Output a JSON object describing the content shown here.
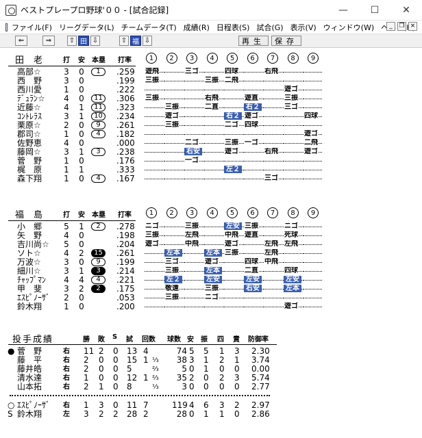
{
  "window": {
    "title": "ベストプレープロ野球'００ - [試合記録]",
    "buttons": [
      "—",
      "☐",
      "✕"
    ]
  },
  "menu": [
    "ファイル(F)",
    "リーグデータ(L)",
    "チームデータ(T)",
    "成績(R)",
    "日程表(S)",
    "試合(G)",
    "表示(V)",
    "ウィンドウ(W)",
    "ヘルプ(H)"
  ],
  "mdi_buttons": [
    "_",
    "❐",
    "×"
  ],
  "toolbar": {
    "left_arrow": "⇐",
    "right_arrow": "⇒",
    "up1": "⇧",
    "ta": "田",
    "down1": "⇩",
    "up2": "⇧",
    "fuku": "福",
    "down2": "⇩",
    "replay": "再生",
    "save": "保存"
  },
  "headers": {
    "ab": "打",
    "h": "安",
    "hr": "本塁",
    "avg": "打率",
    "innings": [
      "1",
      "2",
      "3",
      "4",
      "5",
      "6",
      "7",
      "8",
      "9"
    ]
  },
  "team1": {
    "name": "田老",
    "players": [
      {
        "name": "高部☆",
        "ab": "3",
        "h": "0",
        "hr": "1",
        "hr_style": "open",
        "avg": ".259",
        "res": [
          "遊飛",
          "",
          "三ゴ",
          "",
          "四球",
          "",
          "右飛",
          "",
          ""
        ]
      },
      {
        "name": "西　野",
        "ab": "3",
        "h": "0",
        "hr": "",
        "avg": ".199",
        "res": [
          "三振",
          "",
          "",
          "三振",
          "二飛",
          "",
          "",
          "",
          ""
        ]
      },
      {
        "name": "西川愛",
        "ab": "1",
        "h": "0",
        "hr": "",
        "avg": ".222",
        "res": [
          "",
          "",
          "",
          "",
          "",
          "",
          "",
          "遊ゴ",
          ""
        ]
      },
      {
        "name": "ﾃﾞｭﾗﾝ☆",
        "ab": "4",
        "h": "0",
        "hr": "11",
        "hr_style": "open",
        "avg": ".306",
        "res": [
          "三振",
          "",
          "",
          "右飛",
          "",
          "遊直",
          "",
          "三振",
          ""
        ]
      },
      {
        "name": "近藤☆",
        "ab": "4",
        "h": "1",
        "hr": "11",
        "hr_style": "open",
        "avg": ".323",
        "res": [
          "",
          "三振",
          "",
          "二直",
          "",
          "右２",
          "",
          "三ゴ",
          ""
        ]
      },
      {
        "name": "ｺﾝﾄﾚﾗｽ",
        "ab": "3",
        "h": "1",
        "hr": "10",
        "hr_style": "open",
        "avg": ".234",
        "res": [
          "",
          "遊ゴ",
          "",
          "",
          "右２",
          "遊ゴ",
          "",
          "",
          "四球"
        ]
      },
      {
        "name": "栗原☆",
        "ab": "2",
        "h": "0",
        "hr": "9",
        "hr_style": "open",
        "avg": ".261",
        "res": [
          "",
          "三振",
          "",
          "",
          "二ゴ",
          "四球",
          "",
          "",
          ""
        ]
      },
      {
        "name": "郡司☆",
        "ab": "1",
        "h": "0",
        "hr": "4",
        "hr_style": "open",
        "avg": ".182",
        "res": [
          "",
          "",
          "",
          "",
          "",
          "",
          "",
          "",
          "遊ゴ"
        ]
      },
      {
        "name": "佐野恵",
        "ab": "4",
        "h": "0",
        "hr": "",
        "avg": ".000",
        "res": [
          "",
          "",
          "二ゴ",
          "",
          "三振",
          "一ゴ",
          "",
          "",
          "二飛"
        ]
      },
      {
        "name": "藤岡☆",
        "ab": "3",
        "h": "1",
        "hr": "3",
        "hr_style": "open",
        "avg": ".238",
        "res": [
          "",
          "",
          "右安",
          "",
          "遊ゴ",
          "",
          "右飛",
          "",
          "遊ゴ"
        ]
      },
      {
        "name": "菅　野",
        "ab": "1",
        "h": "0",
        "hr": "",
        "avg": ".176",
        "res": [
          "",
          "",
          "一ゴ",
          "",
          "",
          "",
          "",
          "",
          ""
        ]
      },
      {
        "name": "梶　原",
        "ab": "1",
        "h": "1",
        "hr": "",
        "avg": ".333",
        "res": [
          "",
          "",
          "",
          "",
          "左２",
          "",
          "",
          "",
          ""
        ]
      },
      {
        "name": "森下翔",
        "ab": "1",
        "h": "0",
        "hr": "4",
        "hr_style": "open",
        "avg": ".167",
        "res": [
          "",
          "",
          "",
          "",
          "",
          "",
          "三ゴ",
          "",
          ""
        ]
      }
    ]
  },
  "team2": {
    "name": "福島",
    "players": [
      {
        "name": "小　郷",
        "ab": "5",
        "h": "1",
        "hr": "2",
        "hr_style": "open",
        "avg": ".278",
        "res": [
          "ニゴ",
          "",
          "三振",
          "",
          "左安",
          "三振",
          "",
          "ニゴ",
          ""
        ]
      },
      {
        "name": "矢　野",
        "ab": "4",
        "h": "0",
        "hr": "",
        "avg": ".198",
        "res": [
          "三振",
          "",
          "左飛",
          "",
          "中飛",
          "遊直",
          "",
          "死球",
          ""
        ]
      },
      {
        "name": "吉川尚☆",
        "ab": "5",
        "h": "0",
        "hr": "",
        "avg": ".204",
        "res": [
          "遊ゴ",
          "",
          "中飛",
          "",
          "遊ゴ",
          "",
          "左飛",
          "左飛",
          ""
        ]
      },
      {
        "name": "ソト☆",
        "ab": "4",
        "h": "2",
        "hr": "15",
        "hr_style": "filled",
        "avg": ".261",
        "res": [
          "",
          "左本",
          "",
          "左本",
          "三振",
          "",
          "左飛",
          "",
          ""
        ]
      },
      {
        "name": "万波☆",
        "ab": "3",
        "h": "0",
        "hr": "9",
        "hr_style": "open",
        "avg": ".199",
        "res": [
          "",
          "三ゴ",
          "",
          "遊ゴ",
          "",
          "四球",
          "中飛",
          "",
          ""
        ]
      },
      {
        "name": "細川☆",
        "ab": "3",
        "h": "1",
        "hr": "3",
        "hr_style": "filled",
        "avg": ".214",
        "res": [
          "",
          "三振",
          "",
          "左本",
          "",
          "二直",
          "",
          "四球",
          ""
        ]
      },
      {
        "name": "ﾁｬｯﾌﾟﾏﾝ",
        "ab": "4",
        "h": "4",
        "hr": "4",
        "hr_style": "open",
        "avg": ".221",
        "res": [
          "",
          "左２",
          "",
          "左安",
          "",
          "左安",
          "",
          "左安",
          ""
        ]
      },
      {
        "name": "甲　斐",
        "ab": "3",
        "h": "2",
        "hr": "2",
        "hr_style": "filled",
        "avg": ".175",
        "res": [
          "",
          "敬遠",
          "",
          "三振",
          "",
          "右安",
          "",
          "左本",
          ""
        ]
      },
      {
        "name": "ｴｽﾋﾟﾉｰｻﾞ",
        "ab": "2",
        "h": "0",
        "hr": "",
        "avg": ".053",
        "res": [
          "",
          "三振",
          "",
          "ニゴ",
          "",
          "",
          "",
          "",
          ""
        ]
      },
      {
        "name": "鈴木翔",
        "ab": "1",
        "h": "0",
        "hr": "",
        "avg": ".200",
        "res": [
          "",
          "",
          "",
          "",
          "",
          "",
          "",
          "遊ゴ",
          ""
        ]
      }
    ]
  },
  "pitching": {
    "title": "投手成績",
    "headers": [
      "勝",
      "敗",
      "S",
      "試",
      "回数",
      "球数",
      "安",
      "振",
      "四",
      "責",
      "防御率"
    ],
    "team1": [
      {
        "mark": "●",
        "name": "菅　野",
        "hand": "右",
        "w": "11",
        "l": "2",
        "s": "0",
        "g": "13",
        "ip": "4",
        "ipf": "",
        "pc": "74",
        "h": "5",
        "k": "5",
        "bb": "1",
        "er": "3",
        "era": "2.30"
      },
      {
        "mark": "",
        "name": "藤　平",
        "hand": "右",
        "w": "2",
        "l": "0",
        "s": "0",
        "g": "15",
        "ip": "1",
        "ipf": "⅓",
        "pc": "38",
        "h": "3",
        "k": "1",
        "bb": "2",
        "er": "1",
        "era": "3.74"
      },
      {
        "mark": "",
        "name": "藤井皓",
        "hand": "右",
        "w": "2",
        "l": "0",
        "s": "0",
        "g": "5",
        "ip": "",
        "ipf": "⅔",
        "pc": "5",
        "h": "0",
        "k": "1",
        "bb": "0",
        "er": "0",
        "era": "0.00"
      },
      {
        "mark": "",
        "name": "清水達",
        "hand": "右",
        "w": "1",
        "l": "0",
        "s": "0",
        "g": "12",
        "ip": "1",
        "ipf": "⅔",
        "pc": "35",
        "h": "2",
        "k": "0",
        "bb": "2",
        "er": "3",
        "era": "5.74"
      },
      {
        "mark": "",
        "name": "山本拓",
        "hand": "右",
        "w": "2",
        "l": "1",
        "s": "0",
        "g": "8",
        "ip": "",
        "ipf": "⅓",
        "pc": "3",
        "h": "0",
        "k": "0",
        "bb": "0",
        "er": "0",
        "era": "2.77"
      }
    ],
    "team2": [
      {
        "mark": "○",
        "name": "ｴｽﾋﾟﾉｰｻﾞ",
        "hand": "右",
        "w": "1",
        "l": "3",
        "s": "0",
        "g": "11",
        "ip": "7",
        "ipf": "",
        "pc": "119",
        "h": "4",
        "k": "6",
        "bb": "3",
        "er": "2",
        "era": "2.97"
      },
      {
        "mark": "S",
        "name": "鈴木翔",
        "hand": "左",
        "w": "3",
        "l": "2",
        "s": "2",
        "g": "28",
        "ip": "2",
        "ipf": "",
        "pc": "28",
        "h": "0",
        "k": "1",
        "bb": "1",
        "er": "0",
        "era": "2.86"
      }
    ]
  }
}
